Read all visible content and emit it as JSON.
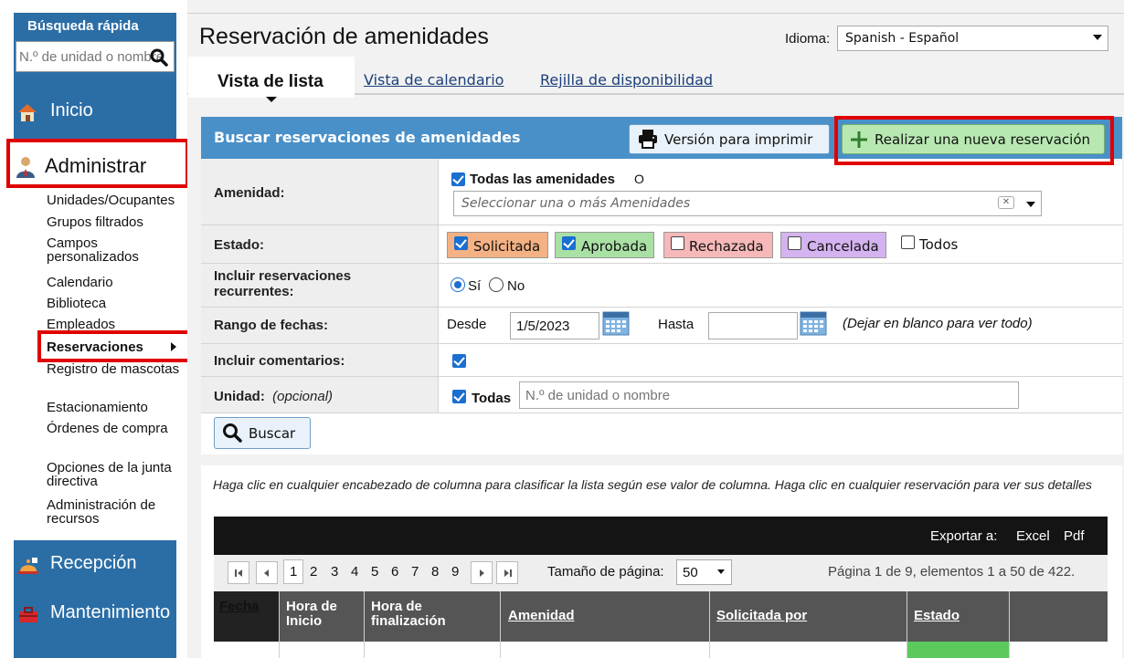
{
  "sidebar": {
    "quick_search_title": "Búsqueda rápida",
    "quick_search_placeholder": "N.º de unidad o nombre",
    "nav": {
      "home": "Inicio",
      "admin": "Administrar",
      "reception": "Recepción",
      "maintenance": "Mantenimiento"
    },
    "admin_items": [
      "Unidades/Ocupantes",
      "Grupos filtrados",
      "Campos personalizados",
      "Calendario",
      "Biblioteca",
      "Empleados",
      "Reservaciones",
      "Registro de mascotas",
      "Estacionamiento",
      "Órdenes de compra",
      "Opciones de la junta directiva",
      "Administración de recursos"
    ]
  },
  "header": {
    "title": "Reservación de amenidades",
    "language_label": "Idioma:",
    "language_value": "Spanish - Español"
  },
  "tabs": [
    "Vista de lista",
    "Vista de calendario",
    "Rejilla de disponibilidad"
  ],
  "panel": {
    "title": "Buscar reservaciones de amenidades",
    "print_button": "Versión para imprimir",
    "new_button": "Realizar una nueva reservación"
  },
  "form": {
    "amenity_label": "Amenidad:",
    "amenity_all": "Todas las amenidades",
    "amenity_or": "O",
    "amenity_placeholder": "Seleccionar una o más Amenidades",
    "status_label": "Estado:",
    "statuses": [
      {
        "label": "Solicitada",
        "checked": true,
        "color": "#f4b183"
      },
      {
        "label": "Aprobada",
        "checked": true,
        "color": "#a9e0a4"
      },
      {
        "label": "Rechazada",
        "checked": false,
        "color": "#f6b8b8"
      },
      {
        "label": "Cancelada",
        "checked": false,
        "color": "#d4b3f0"
      },
      {
        "label": "Todos",
        "checked": false,
        "color": ""
      }
    ],
    "recurring_label": "Incluir reservaciones recurrentes:",
    "recurring_yes": "Sí",
    "recurring_no": "No",
    "date_label": "Rango de fechas:",
    "date_from_label": "Desde",
    "date_from_value": "1/5/2023",
    "date_to_label": "Hasta",
    "date_to_value": "",
    "date_hint": "(Dejar en blanco para ver todo)",
    "comments_label": "Incluir comentarios:",
    "unit_label": "Unidad:",
    "unit_optional": "(opcional)",
    "unit_all": "Todas",
    "unit_placeholder": "N.º de unidad o nombre",
    "search_button": "Buscar"
  },
  "list": {
    "hint": "Haga clic en cualquier encabezado de columna para clasificar la lista según ese valor de columna. Haga clic en cualquier reservación para ver sus detalles",
    "export_label": "Exportar a:",
    "export_excel": "Excel",
    "export_pdf": "Pdf",
    "pages": [
      "1",
      "2",
      "3",
      "4",
      "5",
      "6",
      "7",
      "8",
      "9"
    ],
    "current_page": "1",
    "page_size_label": "Tamaño de página:",
    "page_size_value": "50",
    "page_info": "Página 1 de 9, elementos 1 a 50 de 422.",
    "columns": [
      "Fecha",
      "Hora de Inicio",
      "Hora de finalización",
      "Amenidad",
      "Solicitada por",
      "Estado"
    ]
  }
}
